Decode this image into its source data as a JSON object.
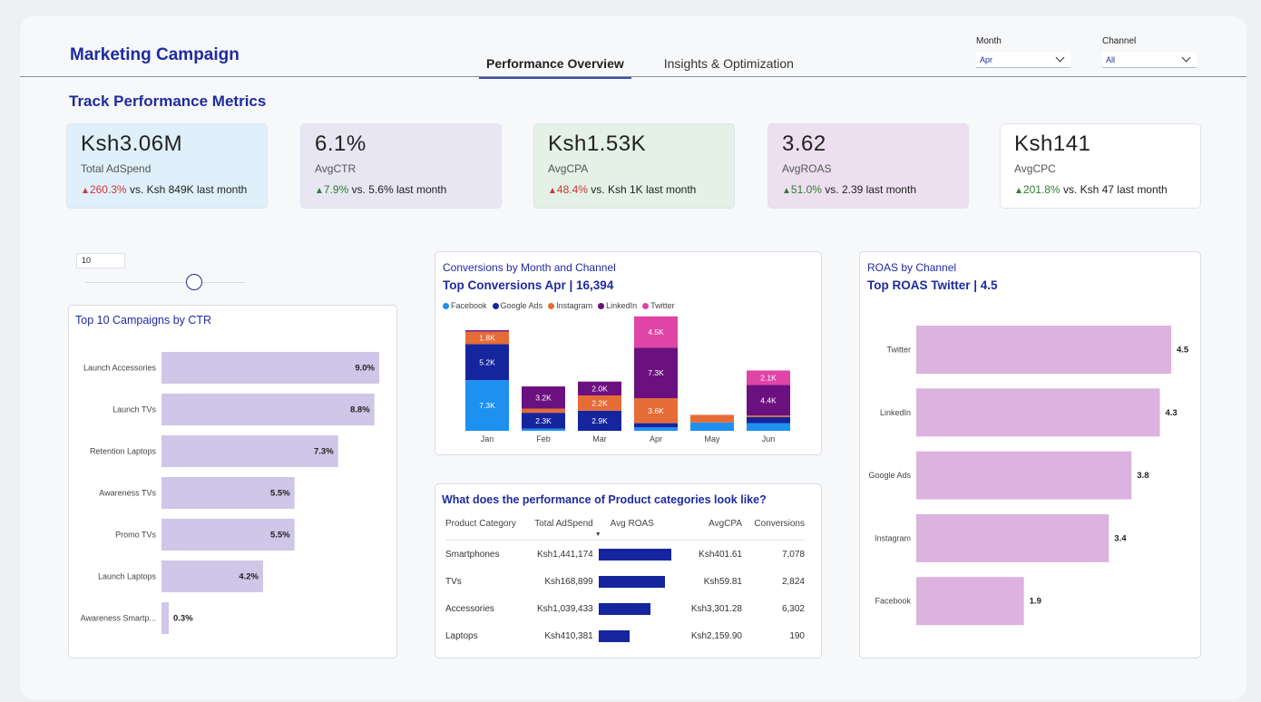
{
  "header": {
    "title": "Marketing Campaign",
    "tabs": [
      {
        "label": "Performance Overview",
        "active": true
      },
      {
        "label": "Insights & Optimization",
        "active": false
      }
    ],
    "filters": {
      "month": {
        "label": "Month",
        "value": "Apr"
      },
      "channel": {
        "label": "Channel",
        "value": "All"
      }
    }
  },
  "section_title": "Track Performance Metrics",
  "kpis": [
    {
      "value": "Ksh3.06M",
      "label": "Total AdSpend",
      "delta": "260.3%",
      "compare": " vs. Ksh 849K last month",
      "direction": "up",
      "delta_color": "#d13438",
      "bg": "#dff0fa"
    },
    {
      "value": "6.1%",
      "label": "AvgCTR",
      "delta": "7.9%",
      "compare": " vs. 5.6% last month",
      "direction": "up",
      "delta_color": "#2e7d32",
      "bg": "#e8e6f3"
    },
    {
      "value": "Ksh1.53K",
      "label": "AvgCPA",
      "delta": "48.4%",
      "compare": " vs. Ksh 1K last month",
      "direction": "up",
      "delta_color": "#d13438",
      "bg": "#e3f1e6"
    },
    {
      "value": "3.62",
      "label": "AvgROAS",
      "delta": "51.0%",
      "compare": " vs. 2.39 last month",
      "direction": "up",
      "delta_color": "#2e7d32",
      "bg": "#eddff0"
    },
    {
      "value": "Ksh141",
      "label": "AvgCPC",
      "delta": "201.8%",
      "compare": " vs. Ksh 47 last month",
      "direction": "up",
      "delta_color": "#2e7d32",
      "bg": "#ffffff"
    }
  ],
  "top_n": {
    "value": "10",
    "slider_fraction": 0.68
  },
  "chart_data": [
    {
      "type": "bar",
      "orientation": "horizontal",
      "title": "Top 10 Campaigns by CTR",
      "categories": [
        "Launch Accessories",
        "Launch TVs",
        "Retention Laptops",
        "Awareness TVs",
        "Promo TVs",
        "Launch Laptops",
        "Awareness Smartp..."
      ],
      "values": [
        9.0,
        8.8,
        7.3,
        5.5,
        5.5,
        4.2,
        0.3
      ],
      "data_labels": [
        "9.0%",
        "8.8%",
        "7.3%",
        "5.5%",
        "5.5%",
        "4.2%",
        "0.3%"
      ],
      "xlim": [
        0,
        9.0
      ],
      "color": "#cfc6e8"
    },
    {
      "type": "bar",
      "stacked": true,
      "caption": "Conversions by Month and Channel",
      "title": "Top Conversions  Apr | 16,394",
      "categories": [
        "Jan",
        "Feb",
        "Mar",
        "Apr",
        "May",
        "Jun"
      ],
      "series": [
        {
          "name": "Facebook",
          "color": "#1e90ef",
          "values": [
            7300,
            300,
            0,
            500,
            1200,
            1100
          ],
          "labels": [
            "7.3K",
            "",
            "",
            "",
            "",
            ""
          ]
        },
        {
          "name": "Google Ads",
          "color": "#15259e",
          "values": [
            5200,
            2300,
            2900,
            600,
            0,
            900
          ],
          "labels": [
            "5.2K",
            "2.3K",
            "2.9K",
            "",
            "",
            ""
          ]
        },
        {
          "name": "Instagram",
          "color": "#e66c37",
          "values": [
            1800,
            600,
            2200,
            3600,
            1100,
            200
          ],
          "labels": [
            "1.8K",
            "",
            "2.2K",
            "3.6K",
            "",
            ""
          ]
        },
        {
          "name": "LinkedIn",
          "color": "#6b107f",
          "values": [
            200,
            3200,
            2000,
            7300,
            0,
            4400
          ],
          "labels": [
            "",
            "3.2K",
            "2.0K",
            "7.3K",
            "",
            "4.4K"
          ]
        },
        {
          "name": "Twitter",
          "color": "#e044a7",
          "values": [
            0,
            0,
            0,
            4500,
            0,
            2100
          ],
          "labels": [
            "",
            "",
            "",
            "4.5K",
            "",
            "2.1K"
          ]
        }
      ],
      "ylim": [
        0,
        17000
      ]
    },
    {
      "type": "bar",
      "orientation": "horizontal",
      "caption": "ROAS by Channel",
      "title": "Top ROAS  Twitter | 4.5",
      "categories": [
        "Twitter",
        "LinkedIn",
        "Google Ads",
        "Instagram",
        "Facebook"
      ],
      "values": [
        4.5,
        4.3,
        3.8,
        3.4,
        1.9
      ],
      "data_labels": [
        "4.5",
        "4.3",
        "3.8",
        "3.4",
        "1.9"
      ],
      "xlim": [
        0,
        4.5
      ],
      "color": "#dcb2de"
    }
  ],
  "product_table": {
    "title": "What does the performance of Product categories look like?",
    "columns": [
      "Product Category",
      "Total AdSpend",
      "Avg ROAS",
      "AvgCPA",
      "Conversions"
    ],
    "max_roas_bar": 1.0,
    "rows": [
      {
        "category": "Smartphones",
        "adspend": "Ksh1,441,174",
        "roas_fraction": 1.0,
        "cpa": "Ksh401.61",
        "conversions": "7,078"
      },
      {
        "category": "TVs",
        "adspend": "Ksh168,899",
        "roas_fraction": 0.91,
        "cpa": "Ksh59.81",
        "conversions": "2,824"
      },
      {
        "category": "Accessories",
        "adspend": "Ksh1,039,433",
        "roas_fraction": 0.71,
        "cpa": "Ksh3,301.28",
        "conversions": "6,302"
      },
      {
        "category": "Laptops",
        "adspend": "Ksh410,381",
        "roas_fraction": 0.42,
        "cpa": "Ksh2,159.90",
        "conversions": "190"
      }
    ],
    "bar_color": "#15259e"
  }
}
